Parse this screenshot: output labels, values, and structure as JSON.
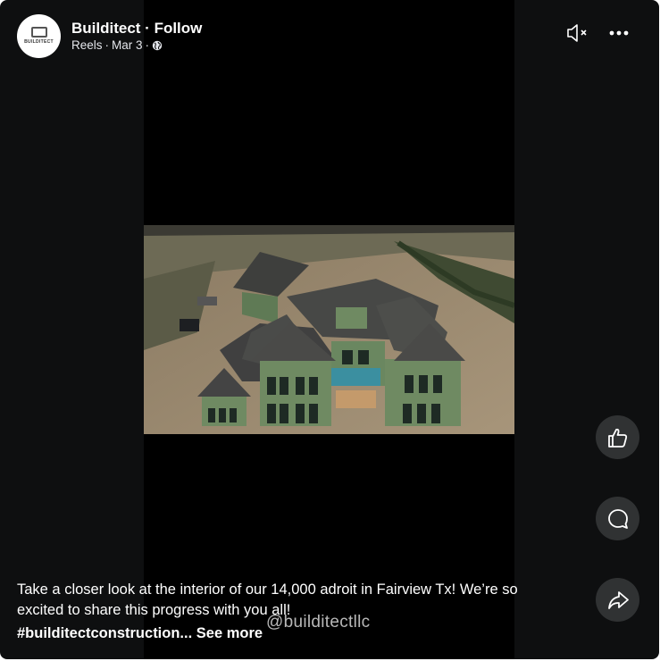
{
  "post": {
    "author": "Builditect",
    "separator": " · ",
    "follow_label": "Follow",
    "source": "Reels",
    "date": "Mar 3",
    "avatar_text": "BUILDITECT",
    "caption": "Take a closer look at the interior of our 14,000 adroit in Fairview Tx! We’re so excited to share this progress with you all!",
    "hashtags": "#builditectconstruction...",
    "see_more_label": "See more",
    "watermark": "@builditectllc"
  },
  "icons": {
    "mute": "speaker-muted-icon",
    "more": "more-options-icon",
    "like": "thumbs-up-icon",
    "comment": "comment-bubble-icon",
    "share": "share-arrow-icon",
    "audience": "globe-icon"
  },
  "colors": {
    "background": "#0e0f10",
    "video_letterbox": "#000000",
    "action_button": "#303233",
    "text": "#ffffff"
  }
}
